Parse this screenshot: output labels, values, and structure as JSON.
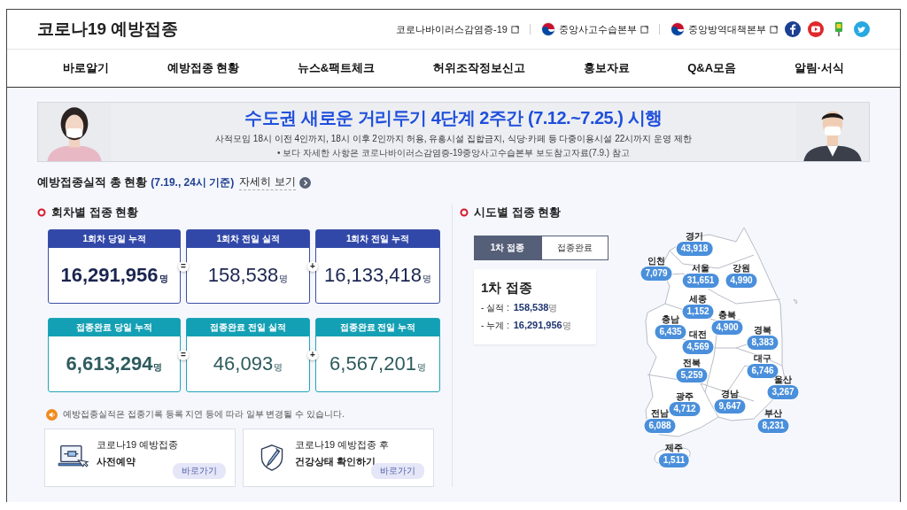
{
  "header": {
    "title": "코로나19 예방접종",
    "links": [
      {
        "kind": "plain",
        "text": "코로나바이러스감염증-19"
      },
      {
        "kind": "emblem",
        "text": "중앙사고수습본부"
      },
      {
        "kind": "emblem",
        "text": "중앙방역대책본부"
      }
    ]
  },
  "nav": [
    "바로알기",
    "예방접종 현황",
    "뉴스&팩트체크",
    "허위조작정보신고",
    "홍보자료",
    "Q&A모음",
    "알림·서식"
  ],
  "banner": {
    "title": "수도권 새로운 거리두기 4단계 2주간 (7.12.~7.25.) 시행",
    "subtitle": "사적모임 18시 이전 4인까지, 18시 이후 2인까지 허용, 유흥시설 집합금지, 식당·카페 등 다중이용시설 22시까지 운영 제한",
    "note": "• 보다 자세한 사항은 코로나바이러스감염증-19중앙사고수습본부 보도참고자료(7.9.) 참고"
  },
  "summary": {
    "title": "예방접종실적 총 현황",
    "date": "(7.19., 24시 기준)",
    "link": "자세히 보기"
  },
  "doses": {
    "title": "회차별 접종 현황",
    "rows": [
      {
        "kind": "first",
        "operators": [
          "=",
          "+"
        ],
        "cells": [
          {
            "label": "1회차 당일 누적",
            "value": "16,291,956",
            "unit": "명"
          },
          {
            "label": "1회차 전일 실적",
            "value": "158,538",
            "unit": "명"
          },
          {
            "label": "1회차 전일 누적",
            "value": "16,133,418",
            "unit": "명"
          }
        ]
      },
      {
        "kind": "complete",
        "operators": [
          "=",
          "+"
        ],
        "cells": [
          {
            "label": "접종완료 당일 누적",
            "value": "6,613,294",
            "unit": "명"
          },
          {
            "label": "접종완료 전일 실적",
            "value": "46,093",
            "unit": "명"
          },
          {
            "label": "접종완료 전일 누적",
            "value": "6,567,201",
            "unit": "명"
          }
        ]
      }
    ]
  },
  "notice": "예방접종실적은 접종기록 등록 지연 등에 따라 일부 변경될 수 있습니다.",
  "cards": [
    {
      "kind": "laptop",
      "line1": "코로나19 예방접종",
      "line2": "사전예약",
      "button": "바로가기"
    },
    {
      "kind": "shield",
      "line1": "코로나19 예방접종 후",
      "line2": "건강상태 확인하기",
      "button": "바로가기"
    }
  ],
  "regional": {
    "title": "시도별 접종 현황",
    "tabs": [
      {
        "label": "1차 접종",
        "selected": true
      },
      {
        "label": "접종완료",
        "selected": false
      }
    ],
    "info": {
      "title": "1차 접종",
      "rows": [
        {
          "label": "- 실적 :",
          "value": "158,538",
          "unit": "명"
        },
        {
          "label": "- 누계 :",
          "value": "16,291,956",
          "unit": "명"
        }
      ]
    },
    "regions": [
      {
        "name": "경기",
        "value": "43,918"
      },
      {
        "name": "인천",
        "value": "7,079"
      },
      {
        "name": "서울",
        "value": "31,651"
      },
      {
        "name": "강원",
        "value": "4,990"
      },
      {
        "name": "세종",
        "value": "1,152"
      },
      {
        "name": "충북",
        "value": "4,900"
      },
      {
        "name": "충남",
        "value": "6,435"
      },
      {
        "name": "대전",
        "value": "4,569"
      },
      {
        "name": "경북",
        "value": "8,383"
      },
      {
        "name": "대구",
        "value": "6,746"
      },
      {
        "name": "전북",
        "value": "5,259"
      },
      {
        "name": "울산",
        "value": "3,267"
      },
      {
        "name": "경남",
        "value": "9,647"
      },
      {
        "name": "광주",
        "value": "4,712"
      },
      {
        "name": "전남",
        "value": "6,088"
      },
      {
        "name": "부산",
        "value": "8,231"
      },
      {
        "name": "제주",
        "value": "1,511"
      }
    ]
  }
}
